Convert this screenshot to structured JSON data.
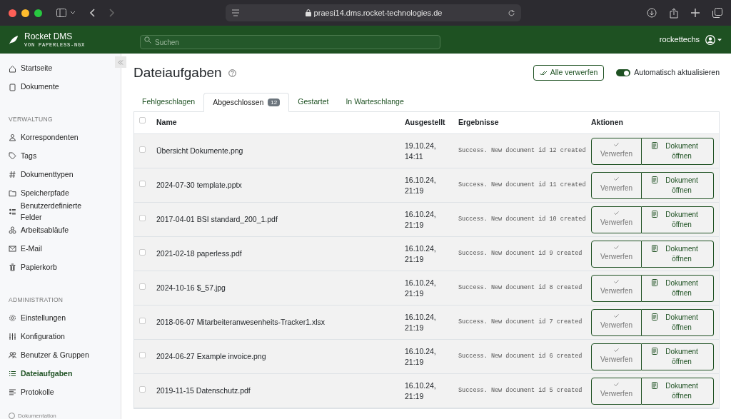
{
  "browser": {
    "url": "praesi14.dms.rocket-technologies.de"
  },
  "header": {
    "app_name": "Rocket DMS",
    "app_subtitle": "VON PAPERLESS-NGX",
    "search": {
      "placeholder": "Suchen"
    },
    "user": "rockettechs"
  },
  "sidebar": {
    "sections": [
      {
        "items": [
          {
            "label": "Startseite",
            "selected": false
          },
          {
            "label": "Dokumente",
            "selected": false
          }
        ]
      },
      {
        "heading": "VERWALTUNG",
        "items": [
          {
            "label": "Korrespondenten",
            "selected": false
          },
          {
            "label": "Tags",
            "selected": false
          },
          {
            "label": "Dokumenttypen",
            "selected": false
          },
          {
            "label": "Speicherpfade",
            "selected": false
          },
          {
            "label": "Benutzerdefinierte Felder",
            "selected": false
          },
          {
            "label": "Arbeitsabläufe",
            "selected": false
          },
          {
            "label": "E-Mail",
            "selected": false
          },
          {
            "label": "Papierkorb",
            "selected": false
          }
        ]
      },
      {
        "heading": "ADMINISTRATION",
        "items": [
          {
            "label": "Einstellungen",
            "selected": false
          },
          {
            "label": "Konfiguration",
            "selected": false
          },
          {
            "label": "Benutzer & Gruppen",
            "selected": false
          },
          {
            "label": "Dateiaufgaben",
            "selected": true
          },
          {
            "label": "Protokolle",
            "selected": false
          }
        ]
      }
    ],
    "footer_link": "Dokumentation"
  },
  "page": {
    "title": "Dateiaufgaben",
    "dismiss_all": "Alle verwerfen",
    "auto_refresh": {
      "label": "Automatisch aktualisieren",
      "on": true
    }
  },
  "tabs": [
    {
      "label": "Fehlgeschlagen",
      "selected": false
    },
    {
      "label": "Abgeschlossen",
      "badge": "12",
      "selected": true
    },
    {
      "label": "Gestartet",
      "selected": false
    },
    {
      "label": "In Warteschlange",
      "selected": false
    }
  ],
  "table": {
    "columns": [
      "Name",
      "Ausgestellt",
      "Ergebnisse",
      "Aktionen"
    ],
    "select_all": {
      "checked": false
    },
    "rows": [
      {
        "name": "Übersicht Dokumente.png",
        "issued": "19.10.24, 14:11",
        "result": "Success. New document id 12 created",
        "checked": false,
        "dismiss": "Verwerfen",
        "open": "Dokument öffnen"
      },
      {
        "name": "2024-07-30 template.pptx",
        "issued": "16.10.24, 21:19",
        "result": "Success. New document id 11 created",
        "checked": false,
        "dismiss": "Verwerfen",
        "open": "Dokument öffnen"
      },
      {
        "name": "2017-04-01 BSI standard_200_1.pdf",
        "issued": "16.10.24, 21:19",
        "result": "Success. New document id 10 created",
        "checked": false,
        "dismiss": "Verwerfen",
        "open": "Dokument öffnen"
      },
      {
        "name": "2021-02-18 paperless.pdf",
        "issued": "16.10.24, 21:19",
        "result": "Success. New document id 9 created",
        "checked": false,
        "dismiss": "Verwerfen",
        "open": "Dokument öffnen"
      },
      {
        "name": "2024-10-16 $_57.jpg",
        "issued": "16.10.24, 21:19",
        "result": "Success. New document id 8 created",
        "checked": false,
        "dismiss": "Verwerfen",
        "open": "Dokument öffnen"
      },
      {
        "name": "2018-06-07 Mitarbeiteranwesenheits-Tracker1.xlsx",
        "issued": "16.10.24, 21:19",
        "result": "Success. New document id 7 created",
        "checked": false,
        "dismiss": "Verwerfen",
        "open": "Dokument öffnen"
      },
      {
        "name": "2024-06-27 Example invoice.png",
        "issued": "16.10.24, 21:19",
        "result": "Success. New document id 6 created",
        "checked": false,
        "dismiss": "Verwerfen",
        "open": "Dokument öffnen"
      },
      {
        "name": "2019-11-15 Datenschutz.pdf",
        "issued": "16.10.24, 21:19",
        "result": "Success. New document id 5 created",
        "checked": false,
        "dismiss": "Verwerfen",
        "open": "Dokument öffnen"
      }
    ]
  }
}
